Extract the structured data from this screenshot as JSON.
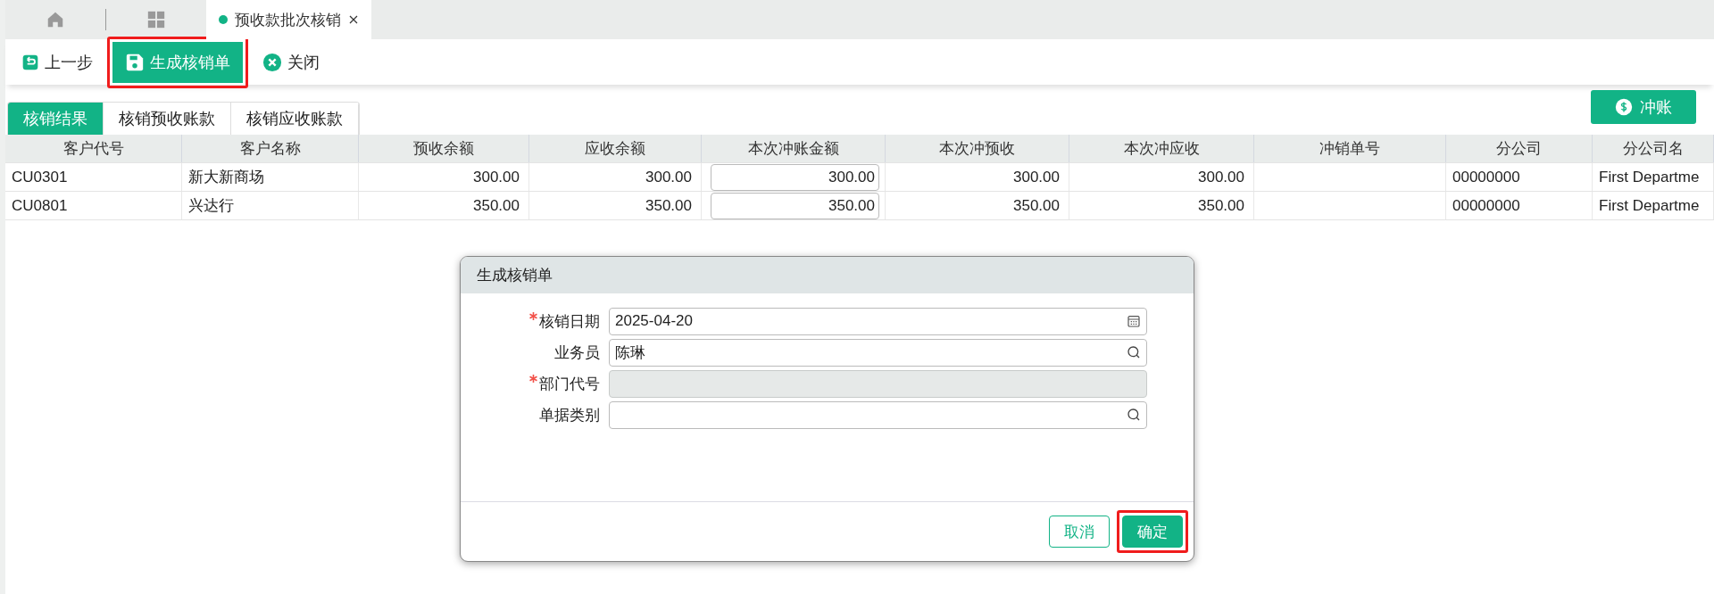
{
  "top_tabs": [
    {
      "kind": "home",
      "selected": false
    },
    {
      "kind": "apps",
      "selected": false
    },
    {
      "kind": "page",
      "label": "预收款批次核销",
      "selected": true
    }
  ],
  "toolbar": [
    {
      "kind": "back",
      "label": "上一步",
      "primary": false,
      "highlighted": false
    },
    {
      "kind": "save",
      "label": "生成核销单",
      "primary": true,
      "highlighted": true
    },
    {
      "kind": "close",
      "label": "关闭",
      "primary": false,
      "highlighted": false
    }
  ],
  "sub_tabs": [
    {
      "label": "核销结果",
      "selected": true
    },
    {
      "label": "核销预收账款",
      "selected": false
    },
    {
      "label": "核销应收账款",
      "selected": false
    }
  ],
  "action_button": {
    "label": "冲账"
  },
  "table": {
    "columns": [
      {
        "label": "客户代号",
        "kind": "text"
      },
      {
        "label": "客户名称",
        "kind": "text"
      },
      {
        "label": "预收余额",
        "kind": "amount"
      },
      {
        "label": "应收余额",
        "kind": "amount"
      },
      {
        "label": "本次冲账金额",
        "kind": "input"
      },
      {
        "label": "本次冲预收",
        "kind": "amount"
      },
      {
        "label": "本次冲应收",
        "kind": "amount"
      },
      {
        "label": "冲销单号",
        "kind": "text"
      },
      {
        "label": "分公司",
        "kind": "text"
      },
      {
        "label": "分公司名",
        "kind": "text"
      }
    ],
    "rows": [
      [
        "CU0301",
        "新大新商场",
        "300.00",
        "300.00",
        "300.00",
        "300.00",
        "300.00",
        "",
        "00000000",
        "First Departme"
      ],
      [
        "CU0801",
        "兴达行",
        "350.00",
        "350.00",
        "350.00",
        "350.00",
        "350.00",
        "",
        "00000000",
        "First Departme"
      ]
    ]
  },
  "dialog": {
    "title": "生成核销单",
    "fields": [
      {
        "label": "核销日期",
        "required": true,
        "kind": "date",
        "value": "2025-04-20",
        "disabled": false
      },
      {
        "label": "业务员",
        "required": false,
        "kind": "lookup",
        "value": "陈琳",
        "disabled": false
      },
      {
        "label": "部门代号",
        "required": true,
        "kind": "plain",
        "disabled": true
      },
      {
        "label": "单据类别",
        "required": false,
        "kind": "lookup",
        "disabled": false
      }
    ],
    "buttons": [
      {
        "label": "取消",
        "primary": false,
        "highlighted": false
      },
      {
        "label": "确定",
        "primary": true,
        "highlighted": true
      }
    ]
  }
}
